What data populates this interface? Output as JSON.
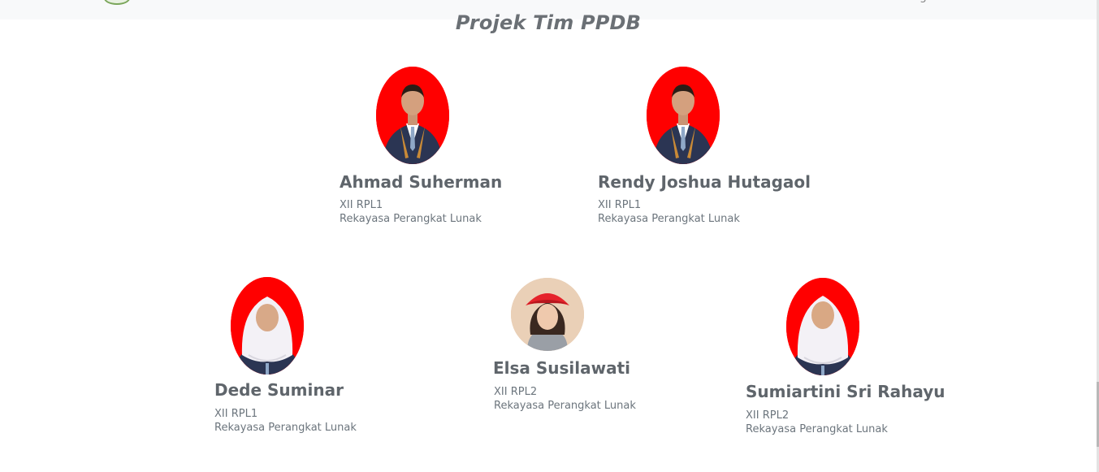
{
  "header": {
    "nav_fragment": "g"
  },
  "section": {
    "title": "Projek Tim PPDB"
  },
  "members": [
    {
      "name": "Ahmad Suherman",
      "class": "XII RPL1",
      "major": "Rekayasa Perangkat Lunak"
    },
    {
      "name": "Rendy Joshua Hutagaol",
      "class": "XII RPL1",
      "major": "Rekayasa Perangkat Lunak"
    },
    {
      "name": "Dede Suminar",
      "class": "XII RPL1",
      "major": "Rekayasa Perangkat Lunak"
    },
    {
      "name": "Elsa Susilawati",
      "class": "XII RPL2",
      "major": "Rekayasa Perangkat Lunak"
    },
    {
      "name": "Sumiartini Sri Rahayu",
      "class": "XII RPL2",
      "major": "Rekayasa Perangkat Lunak"
    }
  ],
  "colors": {
    "photo_background": "#ff0000",
    "text": "#6c757d",
    "topbar": "#f8f9fa"
  }
}
